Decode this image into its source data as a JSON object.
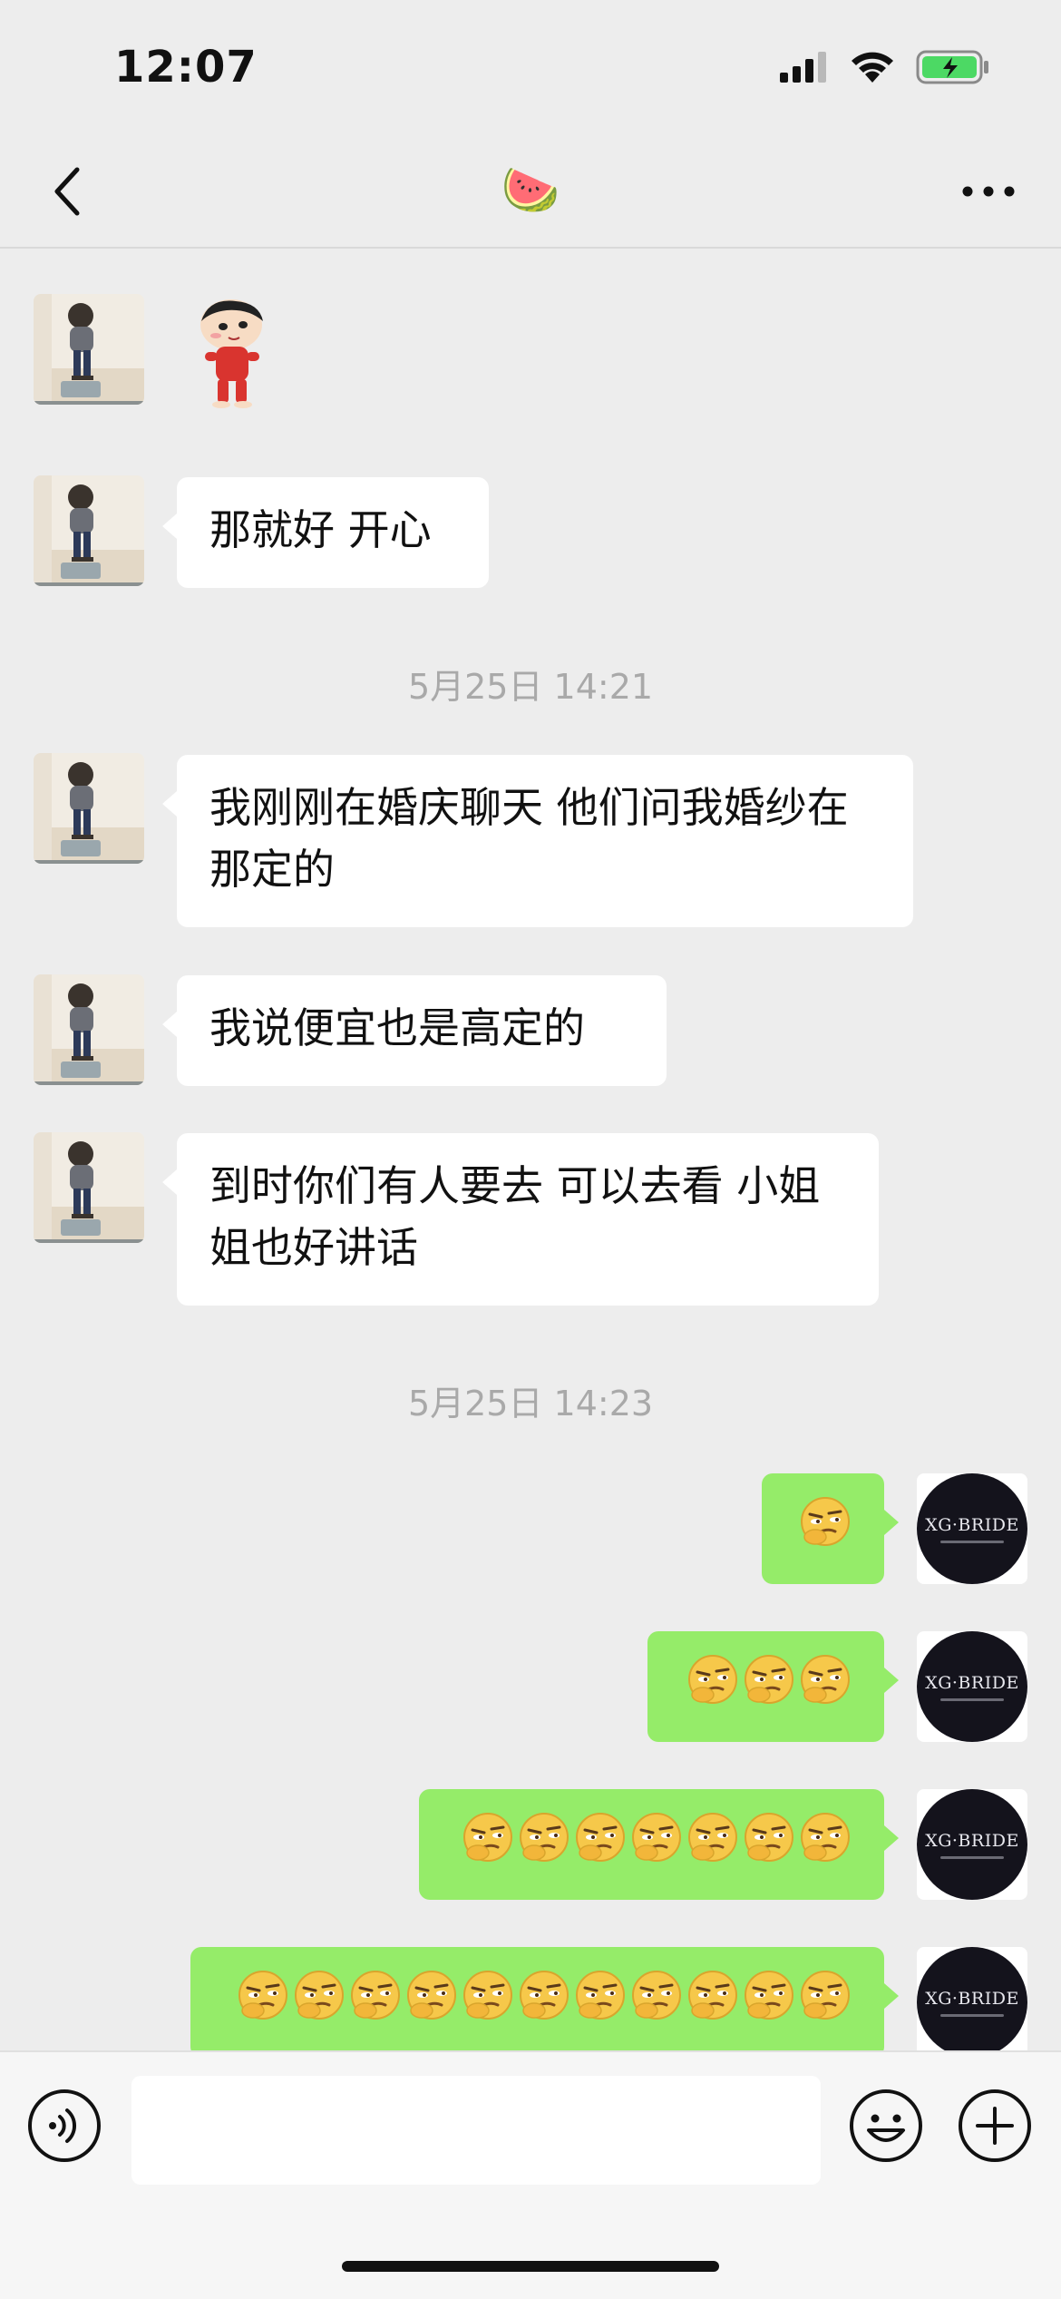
{
  "status_bar": {
    "time": "12:07",
    "battery_color": "#4cd964"
  },
  "nav": {
    "title": "🍉",
    "back_icon": "chevron-left-icon",
    "more_icon": "more-dots-icon"
  },
  "messages": {
    "m1": "那就好 开心",
    "ts1": "5月25日 14:21",
    "m2": "我刚刚在婚庆聊天 他们问我婚纱在那定的",
    "m3": "我说便宜也是高定的",
    "m4": "到时你们有人要去 可以去看 小姐姐也好讲话",
    "ts2": "5月25日 14:23",
    "emoji_counts": [
      1,
      3,
      7,
      11
    ]
  },
  "brand": {
    "name": "XG·BRIDE"
  },
  "input_bar": {
    "placeholder": "",
    "voice_icon": "voice-icon",
    "emoji_icon": "emoji-icon",
    "plus_icon": "plus-icon"
  },
  "colors": {
    "background": "#ededed",
    "self_bubble": "#95ec69",
    "other_bubble": "#ffffff"
  }
}
